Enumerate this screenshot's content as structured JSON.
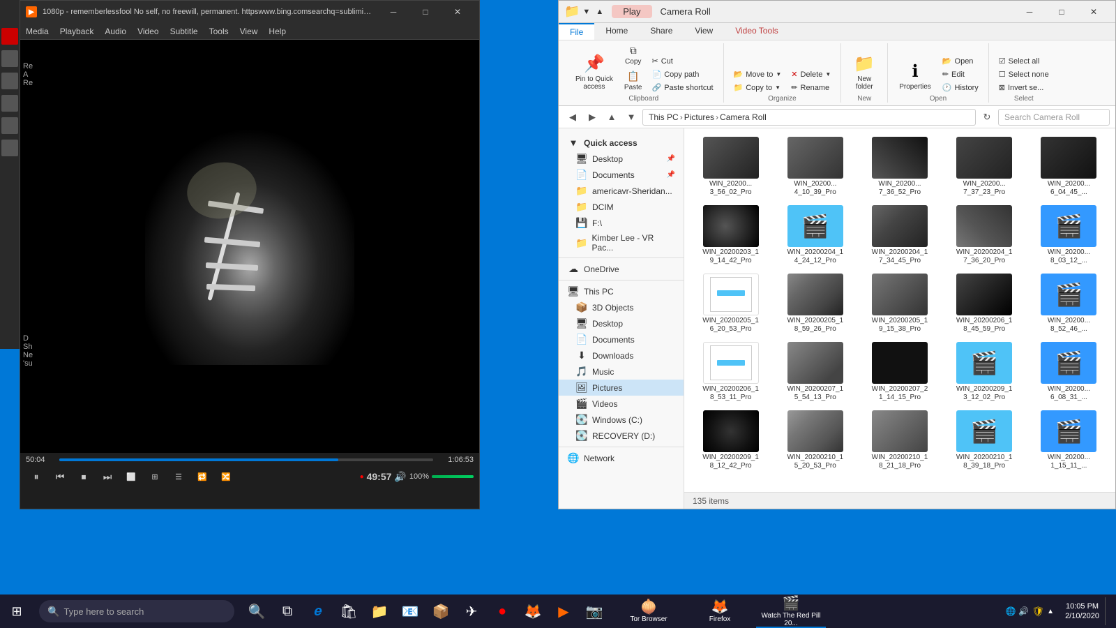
{
  "vlc": {
    "title": "1080p - rememberlessfool No self, no freewill, permanent. httpswww.bing.comsearchq=sublimina...",
    "menu": [
      "Media",
      "Playback",
      "Audio",
      "Video",
      "Subtitle",
      "Tools",
      "View",
      "Help"
    ],
    "time_current": "50:04",
    "time_total": "1:06:53",
    "progress_pct": 74.7,
    "volume_pct": 100,
    "live_time": "49:57",
    "controls": {
      "play": "⏸",
      "prev": "⏮",
      "stop": "⏹",
      "next": "⏭",
      "toggle_view": "⬜",
      "extended": "≡",
      "loop": "🔁",
      "random": "🔀"
    }
  },
  "explorer": {
    "title": "Camera Roll",
    "play_btn": "Play",
    "tabs": [
      "ribbon_tab_file",
      "ribbon_tab_home",
      "ribbon_tab_share",
      "ribbon_tab_view",
      "ribbon_tab_videotools"
    ],
    "tab_labels": [
      "File",
      "Home",
      "Share",
      "View",
      "Video Tools"
    ],
    "active_tab": "Home",
    "ribbon": {
      "clipboard_group": "Clipboard",
      "organize_group": "Organize",
      "new_group": "New",
      "open_group": "Open",
      "select_group": "Select",
      "btn_pin": "Pin to Quick\naccess",
      "btn_copy": "Copy",
      "btn_paste": "Paste",
      "btn_cut": "Cut",
      "btn_copy_path": "Copy path",
      "btn_paste_shortcut": "Paste shortcut",
      "btn_move_to": "Move to",
      "btn_delete": "Delete",
      "btn_rename": "Rename",
      "btn_copy_to": "Copy to",
      "btn_new_folder": "New\nfolder",
      "btn_properties": "Properties",
      "btn_open": "Open",
      "btn_edit": "Edit",
      "btn_history": "History",
      "btn_select_all": "Select all",
      "btn_select_none": "Select\nnone",
      "btn_invert_sel": "Invert se..."
    },
    "address": {
      "this_pc": "This PC",
      "pictures": "Pictures",
      "camera_roll": "Camera Roll"
    },
    "search_placeholder": "Search Camera Roll",
    "sidebar": {
      "quick_access": "Quick access",
      "desktop": "Desktop",
      "documents": "Documents",
      "americavr": "americavr-Sheridan...",
      "dcim": "DCIM",
      "f_drive": "F:\\",
      "kimber": "Kimber Lee - VR Pac...",
      "onedrive": "OneDrive",
      "this_pc": "This PC",
      "3d_objects": "3D Objects",
      "desktop2": "Desktop",
      "documents2": "Documents",
      "downloads": "Downloads",
      "music": "Music",
      "pictures": "Pictures",
      "videos": "Videos",
      "windows_c": "Windows (C:)",
      "recovery_d": "RECOVERY (D:)",
      "network": "Network"
    },
    "files": [
      {
        "name": "WIN_20200203_19_14_42_Pro",
        "type": "video"
      },
      {
        "name": "WIN_20200204_14_24_12_Pro",
        "type": "folder"
      },
      {
        "name": "WIN_20200204_17_34_45_Pro",
        "type": "video_face"
      },
      {
        "name": "WIN_20200204_17_36_20_Pro",
        "type": "video_face"
      },
      {
        "name": "WIN_20200..._8_03_12_...",
        "type": "video_blue"
      },
      {
        "name": "WIN_20200205_16_20_53_Pro",
        "type": "doc"
      },
      {
        "name": "WIN_20200205_18_59_26_Pro",
        "type": "video_face2"
      },
      {
        "name": "WIN_20200205_19_15_38_Pro",
        "type": "video_face3"
      },
      {
        "name": "WIN_20200206_18_45_59_Pro",
        "type": "video_dark"
      },
      {
        "name": "WIN_20200..._8_52_46_...",
        "type": "video_blue"
      },
      {
        "name": "WIN_20200206_18_53_11_Pro",
        "type": "doc"
      },
      {
        "name": "WIN_20200207_15_54_13_Pro",
        "type": "video_face4"
      },
      {
        "name": "WIN_20200207_21_14_15_Pro",
        "type": "video_dark2"
      },
      {
        "name": "WIN_20200209_13_12_02_Pro",
        "type": "clapper"
      },
      {
        "name": "WIN_20200..._6_08_31_...",
        "type": "video_blue"
      },
      {
        "name": "WIN_20200209_18_12_42_Pro",
        "type": "video_dark3"
      },
      {
        "name": "WIN_20200210_15_20_53_Pro",
        "type": "video_face5"
      },
      {
        "name": "WIN_20200210_18_21_18_Pro",
        "type": "video_face6"
      },
      {
        "name": "WIN_20200210_18_39_18_Pro",
        "type": "clapper2"
      },
      {
        "name": "WIN_20200..._1_15_11_...",
        "type": "video_blue"
      }
    ],
    "status": "135 items"
  },
  "taskbar": {
    "search_placeholder": "Type here to search",
    "apps": [
      {
        "name": "Tor Browser",
        "icon": "🧅"
      },
      {
        "name": "Firefox",
        "icon": "🦊"
      },
      {
        "name": "Watch The Red Pill 20...",
        "icon": "🎬"
      }
    ],
    "time": "10:05 PM",
    "date": "2/10/2020",
    "desktop_label": "Desktop"
  }
}
